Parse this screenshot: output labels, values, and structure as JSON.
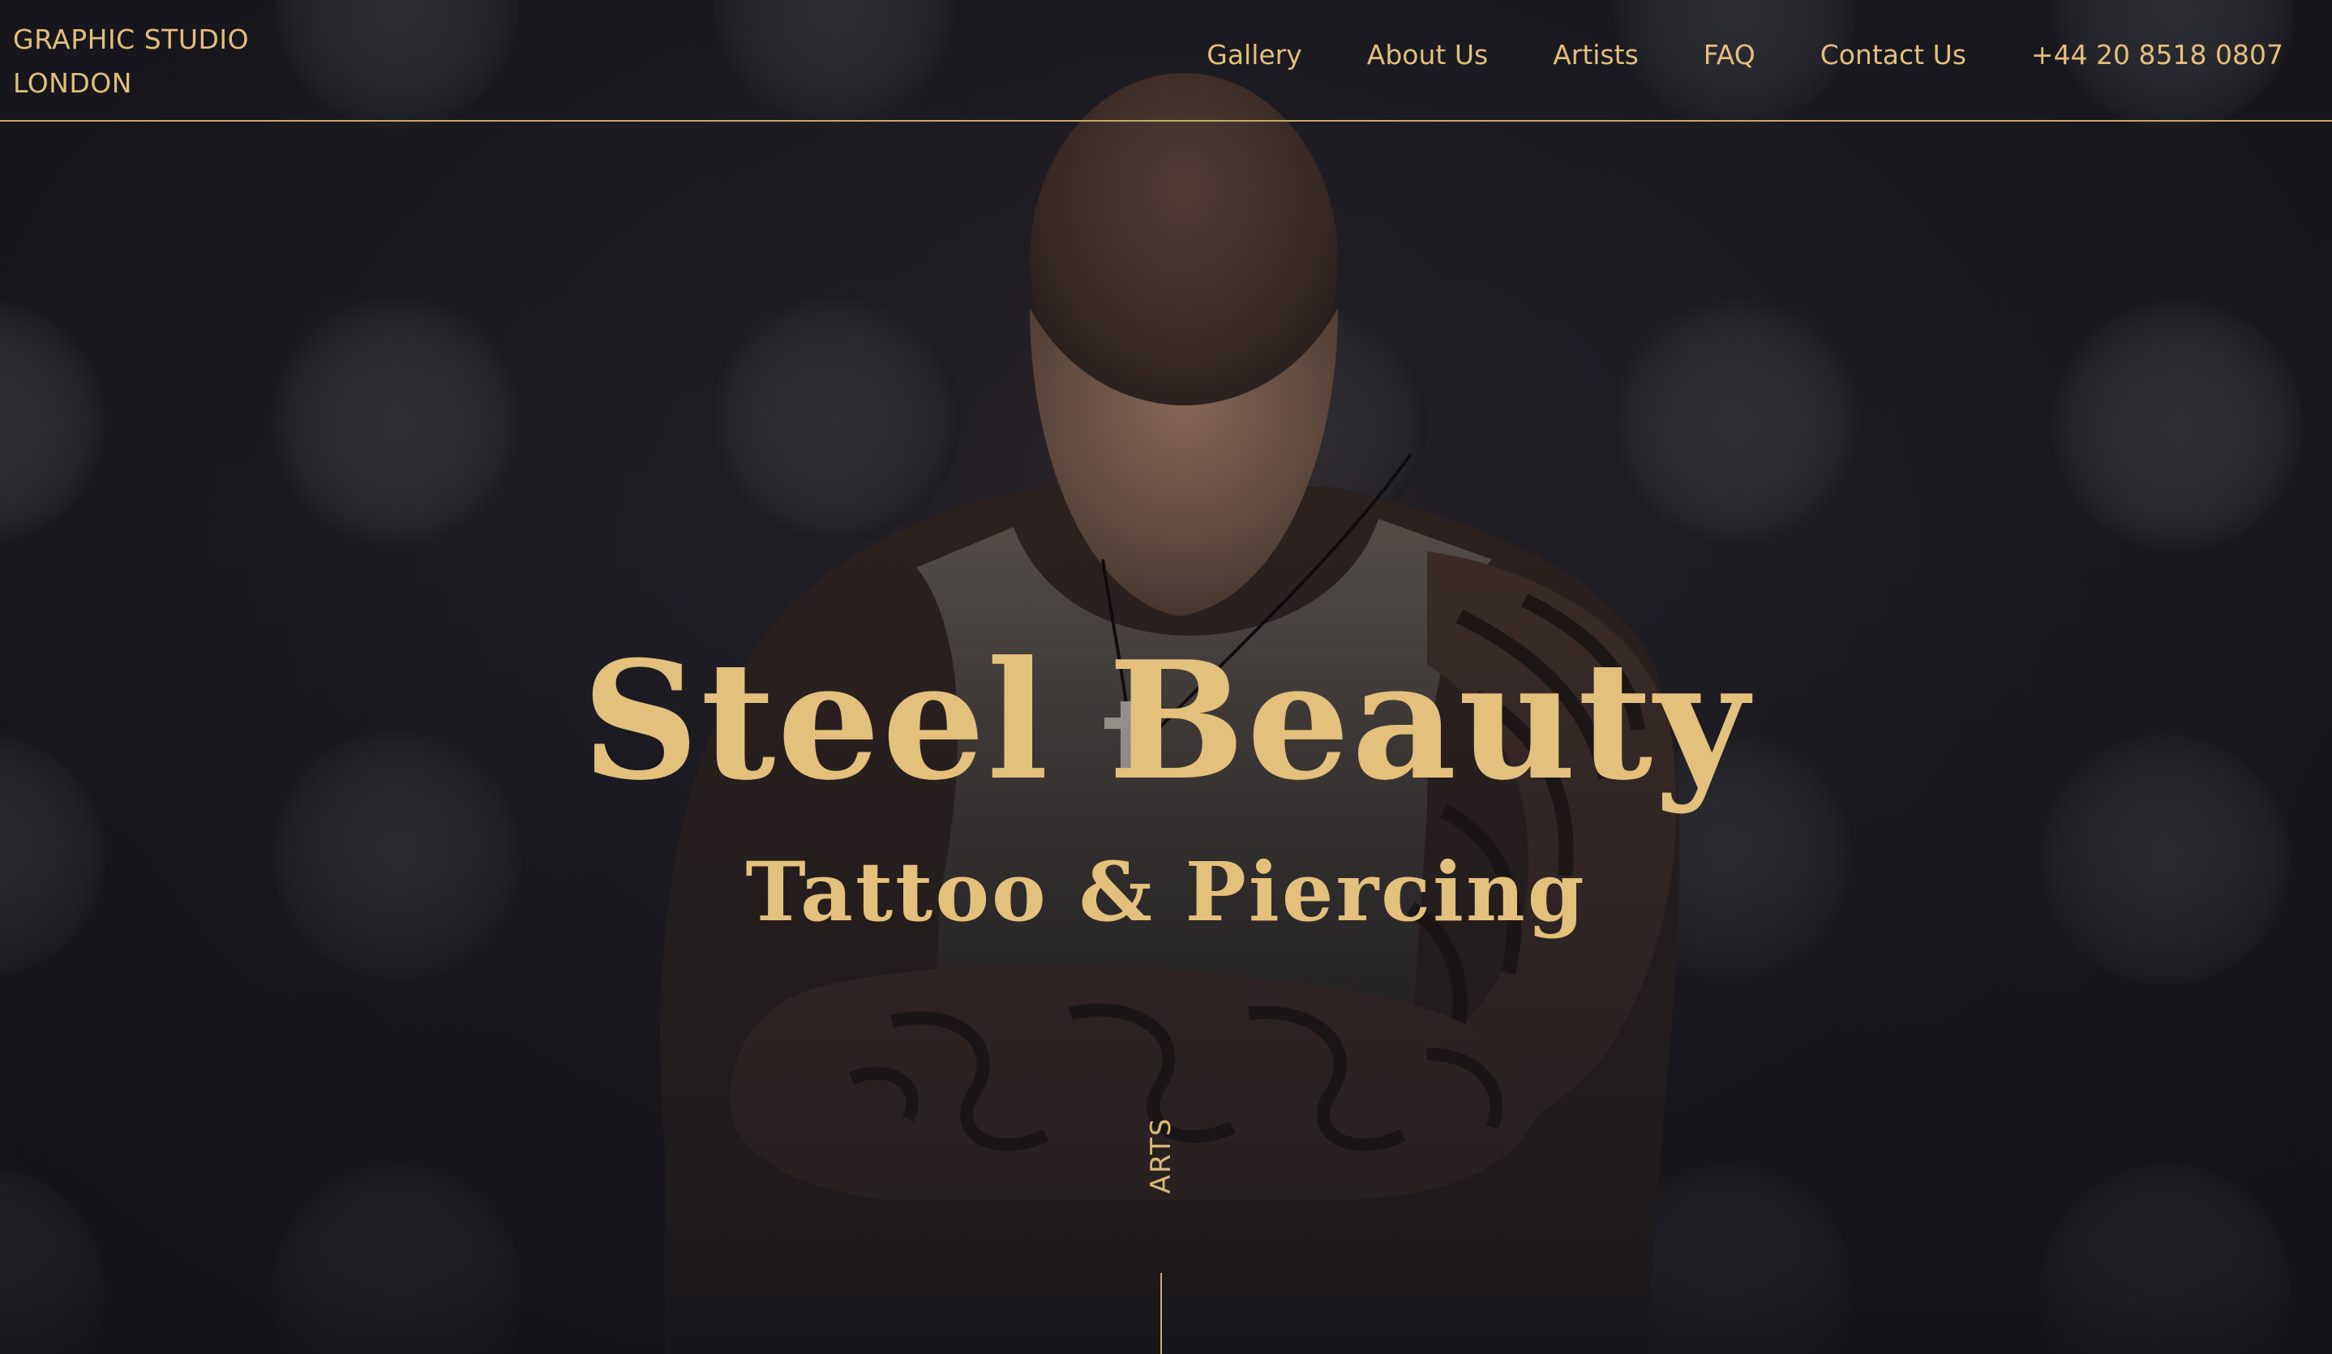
{
  "header": {
    "brand_line1": "GRAPHIC STUDIO",
    "brand_line2": "LONDON",
    "nav": [
      {
        "label": "Gallery"
      },
      {
        "label": "About Us"
      },
      {
        "label": "Artists"
      },
      {
        "label": "FAQ"
      },
      {
        "label": "Contact Us"
      },
      {
        "label": "+44 20 8518 0807"
      }
    ]
  },
  "hero": {
    "title": "Steel Beauty",
    "subtitle": "Tattoo & Piercing",
    "vertical_label": "ARTS",
    "figure_icon": "tattooed-man-photo"
  },
  "colors": {
    "background": "#17171c",
    "accent_gold": "#e4c07d",
    "divider": "#c9a86a"
  }
}
